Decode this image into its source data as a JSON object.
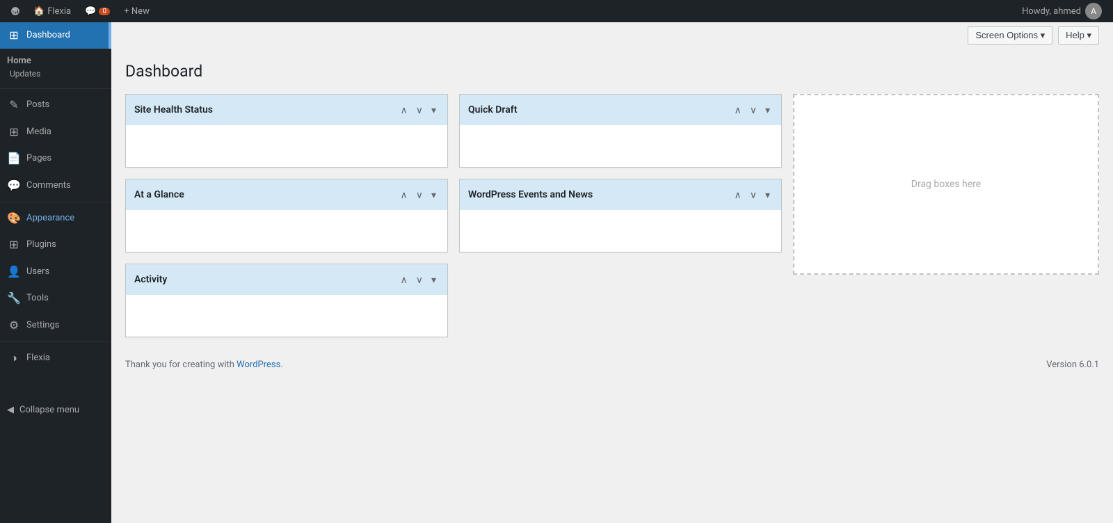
{
  "adminbar": {
    "logo_symbol": "W",
    "site_name": "Flexia",
    "comments_label": "Comments",
    "comments_count": "0",
    "new_label": "+ New",
    "howdy_text": "Howdy, ahmed",
    "avatar_initial": "A"
  },
  "screen_options": {
    "label": "Screen Options ▾"
  },
  "help": {
    "label": "Help ▾"
  },
  "page": {
    "title": "Dashboard"
  },
  "sidebar": {
    "home_label": "Home",
    "updates_label": "Updates",
    "items": [
      {
        "label": "Posts",
        "icon": "📄",
        "name": "posts"
      },
      {
        "label": "Media",
        "icon": "🖼",
        "name": "media"
      },
      {
        "label": "Pages",
        "icon": "📋",
        "name": "pages"
      },
      {
        "label": "Comments",
        "icon": "💬",
        "name": "comments"
      },
      {
        "label": "Appearance",
        "icon": "🎨",
        "name": "appearance"
      },
      {
        "label": "Plugins",
        "icon": "🔌",
        "name": "plugins"
      },
      {
        "label": "Users",
        "icon": "👤",
        "name": "users"
      },
      {
        "label": "Tools",
        "icon": "🔧",
        "name": "tools"
      },
      {
        "label": "Settings",
        "icon": "⚙️",
        "name": "settings"
      },
      {
        "label": "Flexia",
        "icon": "◑",
        "name": "flexia"
      }
    ],
    "collapse_label": "Collapse menu"
  },
  "widgets": {
    "col1": [
      {
        "title": "Site Health Status",
        "name": "site-health-status"
      },
      {
        "title": "At a Glance",
        "name": "at-a-glance"
      },
      {
        "title": "Activity",
        "name": "activity"
      }
    ],
    "col2": [
      {
        "title": "Quick Draft",
        "name": "quick-draft"
      },
      {
        "title": "WordPress Events and News",
        "name": "wp-events-news"
      }
    ],
    "col3": {
      "drag_text": "Drag boxes here"
    }
  },
  "footer": {
    "thank_you_text": "Thank you for creating with ",
    "wp_link_label": "WordPress",
    "version_label": "Version 6.0.1"
  }
}
